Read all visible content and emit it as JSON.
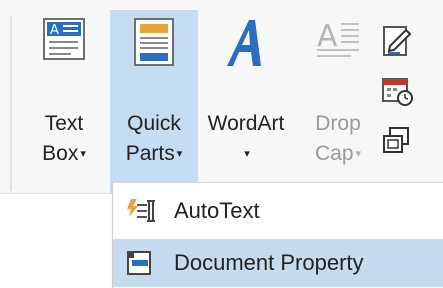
{
  "ribbon": {
    "text_box": {
      "line1": "Text",
      "line2": "Box",
      "caret": "▾"
    },
    "quick_parts": {
      "line1": "Quick",
      "line2": "Parts",
      "caret": "▾"
    },
    "wordart": {
      "line1": "WordArt",
      "caret": "▾"
    },
    "drop_cap": {
      "line1": "Drop",
      "line2": "Cap",
      "caret": "▾",
      "disabled": true
    },
    "small_icons": [
      "signature-line-icon",
      "date-time-icon",
      "object-icon"
    ]
  },
  "quick_parts_menu": {
    "items": [
      {
        "label": "AutoText",
        "icon": "autotext-icon",
        "highlighted": false
      },
      {
        "label": "Document Property",
        "icon": "document-property-icon",
        "highlighted": true
      }
    ]
  },
  "colors": {
    "selected_button_bg": "#c5dcf1",
    "hover_item_bg": "#c7dbef",
    "wordart_blue": "#2b6dc0"
  }
}
